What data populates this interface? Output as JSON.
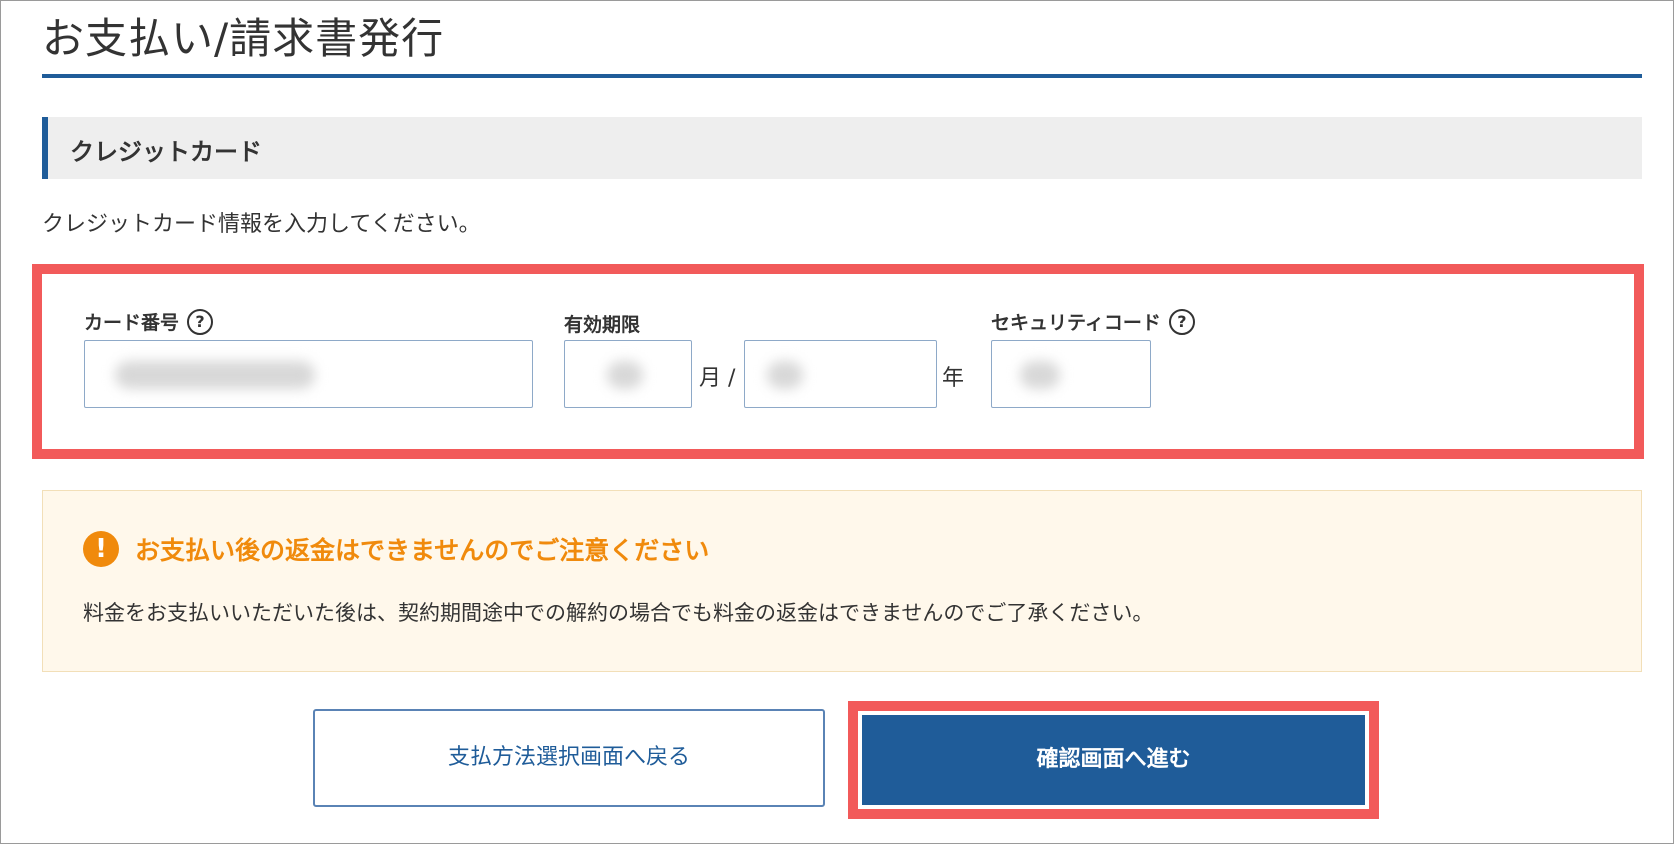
{
  "page": {
    "title": "お支払い/請求書発行"
  },
  "section": {
    "heading": "クレジットカード",
    "intro": "クレジットカード情報を入力してください。"
  },
  "form": {
    "card_number": {
      "label": "カード番号",
      "help": "?",
      "value": ""
    },
    "expiry": {
      "label": "有効期限",
      "month_value": "",
      "month_unit": "月 /",
      "year_value": "",
      "year_unit": "年"
    },
    "security_code": {
      "label": "セキュリティコード",
      "help": "?",
      "value": ""
    }
  },
  "notice": {
    "icon": "!",
    "title": "お支払い後の返金はできませんのでご注意ください",
    "body": "料金をお支払いいただいた後は、契約期間途中での解約の場合でも料金の返金はできませんのでご了承ください。"
  },
  "buttons": {
    "back_label": "支払方法選択画面へ戻る",
    "next_label": "確認画面へ進む"
  },
  "colors": {
    "accent": "#1f5c99",
    "highlight": "#f25a5a",
    "warning": "#f08a0c",
    "notice_bg": "#fff8eb"
  }
}
